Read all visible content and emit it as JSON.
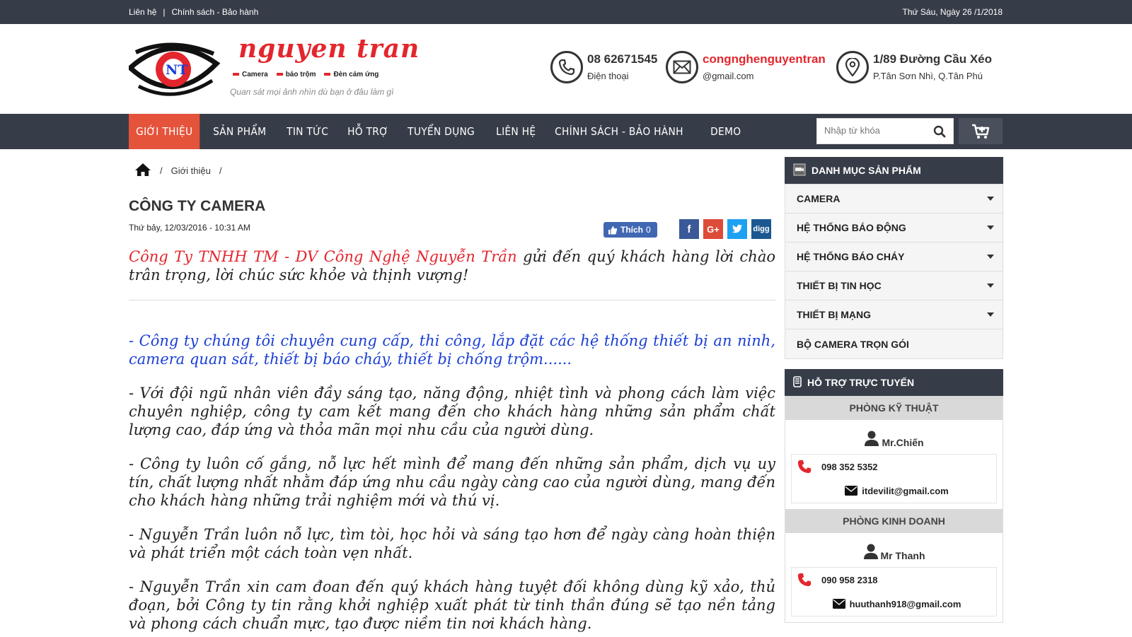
{
  "topbar": {
    "links": [
      "Liên hệ",
      "Chính sách - Bảo hành"
    ],
    "date": "Thứ Sáu, Ngày 26 /1/2018"
  },
  "logo": {
    "brand": "nguyen tran",
    "tags": [
      "Camera",
      "báo trộm",
      "Đèn cảm ứng"
    ],
    "slogan": "Quan sát mọi ảnh nhìn dù bạn ở đâu làm gì"
  },
  "contacts": {
    "phone": {
      "title": "08 62671545",
      "sub": "Điện thoại",
      "icon": "phone-icon"
    },
    "email": {
      "title": "congnghenguyentran",
      "sub": "@gmail.com",
      "icon": "mail-icon"
    },
    "address": {
      "title": "1/89 Đường Cầu Xéo",
      "sub": "P.Tân Sơn Nhì, Q.Tân Phú",
      "icon": "location-icon"
    }
  },
  "nav": {
    "items": [
      "GIỚI THIỆU",
      "SẢN PHẨM",
      "TIN TỨC",
      "HỖ TRỢ",
      "TUYỂN DỤNG",
      "LIÊN HỆ",
      "CHÍNH SÁCH - BẢO HÀNH",
      "DEMO"
    ],
    "active": "GIỚI THIỆU",
    "search_placeholder": "Nhập từ khóa"
  },
  "breadcrumb": {
    "current": "Giới thiệu"
  },
  "article": {
    "title": "CÔNG TY CAMERA",
    "date": "Thứ bảy, 12/03/2016 - 10:31 AM",
    "like_label": "Thích",
    "like_count": "0",
    "lead_red": "Công Ty TNHH TM - DV Công Nghệ Nguyễn Trần",
    "lead_rest": " gửi đến quý khách hàng lời chào trân trọng, lời chúc sức khỏe và thịnh vượng!",
    "p1": "- Công ty chúng tôi chuyên cung cấp, thi công, lắp đặt các hệ thống thiết bị an ninh, camera quan sát, thiết bị báo cháy, thiết bị chống trộm......",
    "p2": "- Với đội ngũ nhân viên đầy sáng tạo, năng động, nhiệt tình và phong cách làm việc chuyên nghiệp, công ty cam kết mang đến cho khách hàng những sản phẩm chất lượng cao, đáp ứng và thỏa mãn mọi nhu cầu của người dùng.",
    "p3": "- Công ty luôn cố gắng, nỗ lực hết mình để mang đến những sản phẩm, dịch vụ uy tín, chất lượng nhất nhằm đáp ứng nhu cầu ngày càng cao của người dùng, mang đến cho khách hàng những trải nghiệm mới và thú vị.",
    "p4": "- Nguyễn Trần luôn nỗ lực, tìm tòi, học hỏi và sáng tạo hơn để ngày càng hoàn thiện và phát triển một cách toàn vẹn nhất.",
    "p5": "- Nguyễn Trần xin cam đoan đến quý khách hàng tuyệt đối không dùng kỹ xảo, thủ đoạn, bởi Công ty tin rằng khởi nghiệp xuất phát từ tinh thần đúng sẽ tạo nền tảng và phong cách chuẩn mực, tạo được niềm tin nơi khách hàng."
  },
  "sidebar": {
    "categories_title": "DANH MỤC SẢN PHẨM",
    "categories": [
      "CAMERA",
      "HỆ THỐNG BÁO ĐỘNG",
      "HỆ THỐNG BÁO CHÁY",
      "THIẾT BỊ TIN HỌC",
      "THIẾT BỊ MẠNG",
      "BỘ CAMERA TRỌN GÓI"
    ],
    "support_title": "HỖ TRỢ TRỰC TUYẾN",
    "support": [
      {
        "dept": "PHÒNG KỸ THUẬT",
        "name": "Mr.Chiến",
        "phone": "098 352 5352",
        "email": "itdevilit@gmail.com"
      },
      {
        "dept": "PHÒNG KINH DOANH",
        "name": "Mr Thanh",
        "phone": "090 958 2318",
        "email": "huuthanh918@gmail.com"
      }
    ]
  },
  "colors": {
    "dark_bar": "#373d48",
    "accent": "#e5533b",
    "brand_red": "#e3262d",
    "link_blue": "#1a3fd6"
  }
}
